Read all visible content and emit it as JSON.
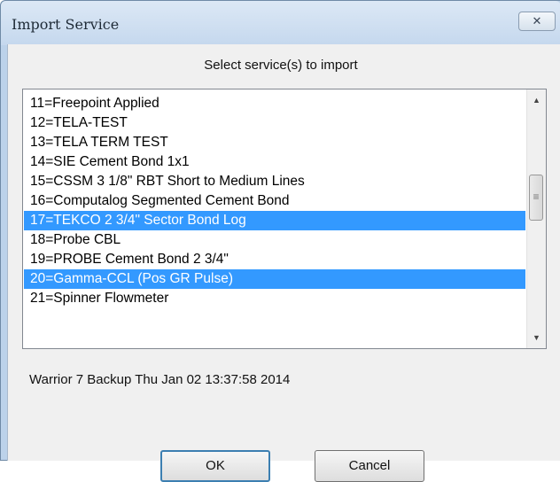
{
  "window": {
    "title": "Import Service",
    "close_glyph": "✕"
  },
  "prompt": "Select service(s) to import",
  "services": [
    {
      "label": "11=Freepoint Applied",
      "selected": false
    },
    {
      "label": "12=TELA-TEST",
      "selected": false
    },
    {
      "label": "13=TELA TERM TEST",
      "selected": false
    },
    {
      "label": "14=SIE Cement Bond 1x1",
      "selected": false
    },
    {
      "label": "15=CSSM 3 1/8\" RBT Short to Medium Lines",
      "selected": false
    },
    {
      "label": "16=Computalog Segmented Cement Bond",
      "selected": false
    },
    {
      "label": "17=TEKCO 2 3/4\" Sector Bond Log",
      "selected": true
    },
    {
      "label": "18=Probe CBL",
      "selected": false
    },
    {
      "label": "19=PROBE Cement Bond 2 3/4\"",
      "selected": false
    },
    {
      "label": "20=Gamma-CCL (Pos GR Pulse)",
      "selected": true
    },
    {
      "label": "21=Spinner Flowmeter",
      "selected": false
    }
  ],
  "scrollbar": {
    "up_glyph": "▲",
    "down_glyph": "▼",
    "thumb_grip": "≡"
  },
  "status": "Warrior 7 Backup Thu Jan 02 13:37:58 2014",
  "buttons": {
    "ok": "OK",
    "cancel": "Cancel"
  }
}
